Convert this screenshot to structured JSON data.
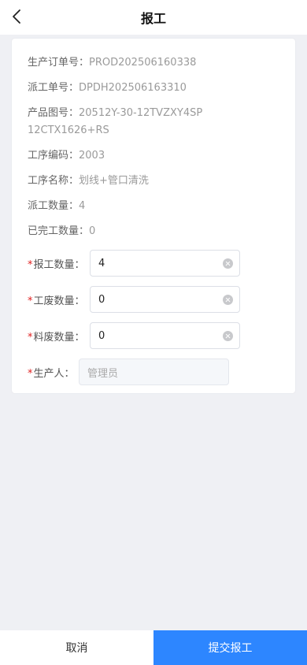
{
  "header": {
    "title": "报工"
  },
  "info": [
    {
      "label": "生产订单号：",
      "value": "PROD202506160338"
    },
    {
      "label": "派工单号：",
      "value": "DPDH202506163310"
    },
    {
      "label": "产品图号：",
      "value": "20512Y-30-12TVZXY4SP12CTX1626+RS"
    },
    {
      "label": "工序编码：",
      "value": "2003"
    },
    {
      "label": "工序名称：",
      "value": "划线+管口清洗"
    },
    {
      "label": "派工数量：",
      "value": "4"
    },
    {
      "label": "已完工数量：",
      "value": "0"
    }
  ],
  "fields": [
    {
      "required": "*",
      "label": "报工数量：",
      "value": "4"
    },
    {
      "required": "*",
      "label": "工废数量：",
      "value": "0"
    },
    {
      "required": "*",
      "label": "料废数量：",
      "value": "0"
    },
    {
      "required": "*",
      "label": "生产人：",
      "value": "管理员"
    }
  ],
  "footer": {
    "cancel_label": "取消",
    "submit_label": "提交报工"
  },
  "colors": {
    "primary": "#2d86ff",
    "required": "#e02020"
  }
}
